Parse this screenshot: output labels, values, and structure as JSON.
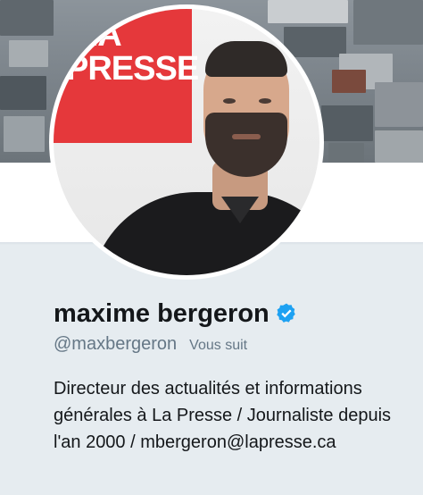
{
  "profile": {
    "name": "maxime bergeron",
    "handle": "@maxbergeron",
    "follows_you": "Vous suit",
    "bio": "Directeur des actualités et informations générales à La Presse / Journaliste depuis l'an 2000 / mberger­on@lapresse.ca",
    "verified": true
  },
  "avatar": {
    "logo_top": "LA",
    "logo_main": "PRESSE"
  },
  "colors": {
    "background": "#e6ecf0",
    "name": "#14171a",
    "secondary_text": "#657786",
    "verified_badge": "#1da1f2",
    "logo_red": "#e5383b"
  },
  "icons": {
    "verified_badge": "verified-badge-icon"
  }
}
